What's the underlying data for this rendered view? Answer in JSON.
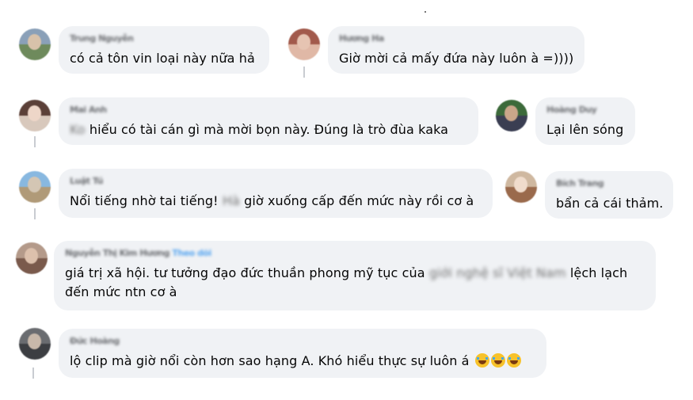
{
  "comments": [
    {
      "author": "Trung Nguyễn",
      "text": "có cả tôn vin loại này nữa hả",
      "avatar_colors": [
        "#8aa0b8",
        "#6e8a5c"
      ],
      "face": "#d8c2aa"
    },
    {
      "author": "Hương Ha",
      "text": "Giờ mời cả mấy đứa này luôn à =))))",
      "avatar_colors": [
        "#a25a4c",
        "#e0b8a6"
      ],
      "face": "#e6c4b2"
    },
    {
      "author": "Mai Anh",
      "text_blurred_prefix": "Ko",
      "text": " hiểu có tài cán gì mà mời bọn này. Đúng là trò đùa kaka",
      "avatar_colors": [
        "#5b4038",
        "#d8c8bc"
      ],
      "face": "#eed6c8"
    },
    {
      "author": "Hoàng Duy",
      "text": "Lại lên sóng",
      "avatar_colors": [
        "#3c6a3a",
        "#3a3e52"
      ],
      "face": "#caa68a"
    },
    {
      "author": "Luật Tú",
      "text_start": "Nổi tiếng nhờ tai tiếng!",
      "text_blurred": " Hà",
      "text_end": " giờ xuống cấp đến mức này rồi cơ à",
      "avatar_colors": [
        "#88b8e0",
        "#b09a78"
      ],
      "face": "#d4c6b4"
    },
    {
      "author": "Bích Trang",
      "text": "bẩn cả cái thảm.",
      "avatar_colors": [
        "#cfb8a0",
        "#9a6a4c"
      ],
      "face": "#f0dccc"
    },
    {
      "author": "Nguyễn Thị Kim Hương",
      "author_link": "Theo dõi",
      "text_start": "giá trị xã hội. tư tưởng đạo đức thuần phong mỹ tục của ",
      "text_blurred": "giới nghệ sĩ Việt Nam",
      "text_end": " lệch lạch đến mức ntn cơ à",
      "avatar_colors": [
        "#b49a8a",
        "#7a5a4c"
      ],
      "face": "#dcc0ac"
    },
    {
      "author": "Đức Hoàng",
      "text": "lộ clip mà giờ nổi còn hơn sao hạng A. Khó hiểu thực sự luôn á",
      "emoji_count": 3,
      "avatar_colors": [
        "#6a6c70",
        "#3c3e42"
      ],
      "face": "#c8b8aa"
    }
  ]
}
